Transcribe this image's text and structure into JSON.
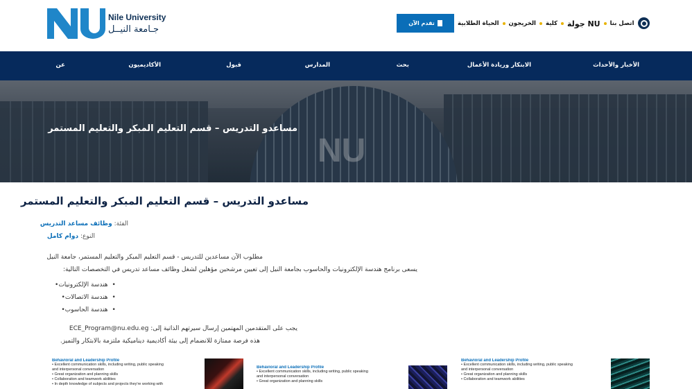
{
  "header": {
    "logo_en": "Nile University",
    "logo_ar": "جـامعة النيــل",
    "apply_label": "تقدم الآن",
    "links": [
      {
        "label": "اتصل بنا",
        "big": false
      },
      {
        "label": "NU جولة",
        "big": true
      },
      {
        "label": "كلية",
        "big": false
      },
      {
        "label": "الخريجون",
        "big": false
      },
      {
        "label": "الحياة الطلابية",
        "big": false
      }
    ]
  },
  "nav": {
    "items": [
      {
        "label": "الأخبار والأحداث"
      },
      {
        "label": "الابتكار وريادة الأعمال"
      },
      {
        "label": "بحث"
      },
      {
        "label": "المدارس"
      },
      {
        "label": "قبول"
      },
      {
        "label": "الأكاديميون"
      },
      {
        "label": "عن"
      }
    ]
  },
  "hero": {
    "title": "مساعدو التدريس – قسم التعليم المبكر والتعليم المستمر",
    "watermark": "NU"
  },
  "content": {
    "title": "مساعدو التدريس – قسم التعليم المبكر والتعليم المستمر",
    "category_label": "الفئة:",
    "category_value": "وظائف مساعد التدريس",
    "type_label": "النوع:",
    "type_value": "دوام كامل",
    "para1": "مطلوب الآن مساعدين للتدريس - قسم التعليم المبكر والتعليم المستمر، جامعة النيل",
    "para2": "يسعى برنامج هندسة الإلكترونيات والحاسوب بجامعة النيل إلى تعيين مرشحين مؤهلين لشغل وظائف مساعد تدريس في التخصصات التالية:",
    "bullets": [
      "هندسة الإلكترونيات",
      "هندسة الاتصالات",
      "هندسة الحاسوب"
    ],
    "para3": "يجب على المتقدمين المهتمين إرسال سيرتهم الذاتية إلى: ECE_Program@nu.edu.eg",
    "para4": "هذه فرصة ممتازة للانضمام إلى بيئة أكاديمية ديناميكية ملتزمة بالابتكار والتميز."
  },
  "flyers": [
    {
      "heading": "Behavioral and Leadership Profile",
      "lines": [
        "• Excellent communication skills, including writing, public speaking",
        "  and interpersonal conversation",
        "• Great organization and planning skills",
        "• Collaboration and teamwork abilities",
        "• In depth knowledge of subjects and projects they're working with"
      ]
    },
    {
      "heading": "Behavioral and Leadership Profile",
      "lines": [
        "• Excellent communication skills, including writing, public speaking",
        "  and interpersonal conversation",
        "• Great organization and planning skills"
      ]
    },
    {
      "heading": "Behavioral and Leadership Profile",
      "lines": [
        "• Excellent communication skills, including writing, public speaking",
        "  and interpersonal conversation",
        "• Great organization and planning skills",
        "• Collaboration and teamwork abilities"
      ]
    }
  ],
  "colors": {
    "brand_blue": "#0a6eb8",
    "nav_navy": "#062a5c",
    "accent_dot": "#e8b300"
  }
}
